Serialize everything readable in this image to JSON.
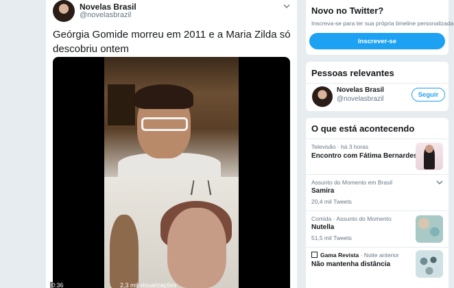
{
  "tweet": {
    "author_name": "Novelas Brasil",
    "author_handle": "@novelasbrazil",
    "text": "Geórgia Gomide morreu em 2011 e a Maria Zilda só descobriu ontem",
    "video": {
      "time": "0:36",
      "views": "2,3 mil visualizações"
    }
  },
  "signup": {
    "title": "Novo no Twitter?",
    "description": "Inscreva-se para ter sua própria timeline personalizada!",
    "button": "Inscrever-se"
  },
  "relevant": {
    "title": "Pessoas relevantes",
    "name": "Novelas Brasil",
    "handle": "@novelasbrazil",
    "follow": "Seguir"
  },
  "trends": {
    "title": "O que está acontecendo",
    "items": [
      {
        "meta": "Televisão · há 3 horas",
        "title": "Encontro com Fátima Bernardes",
        "count": "",
        "icon": "thumbnail"
      },
      {
        "meta": "Assunto do Momento em Brasil",
        "title": "Samira",
        "count": "20,4 mil Tweets",
        "icon": "chevron-down-icon"
      },
      {
        "meta": "Comida · Assunto do Momento",
        "title": "Nutella",
        "count": "51,5 mil Tweets",
        "icon": "chevron-down-icon"
      },
      {
        "meta": "Gama Revista · Noite anterior",
        "meta_source": "Gama Revista",
        "meta_time": "· Noite anterior",
        "title": "Não mantenha distância",
        "count": "",
        "icon": "thumbnail"
      }
    ]
  },
  "colors": {
    "accent": "#1da1f2",
    "background": "#e6ecf0",
    "muted": "#657786"
  }
}
